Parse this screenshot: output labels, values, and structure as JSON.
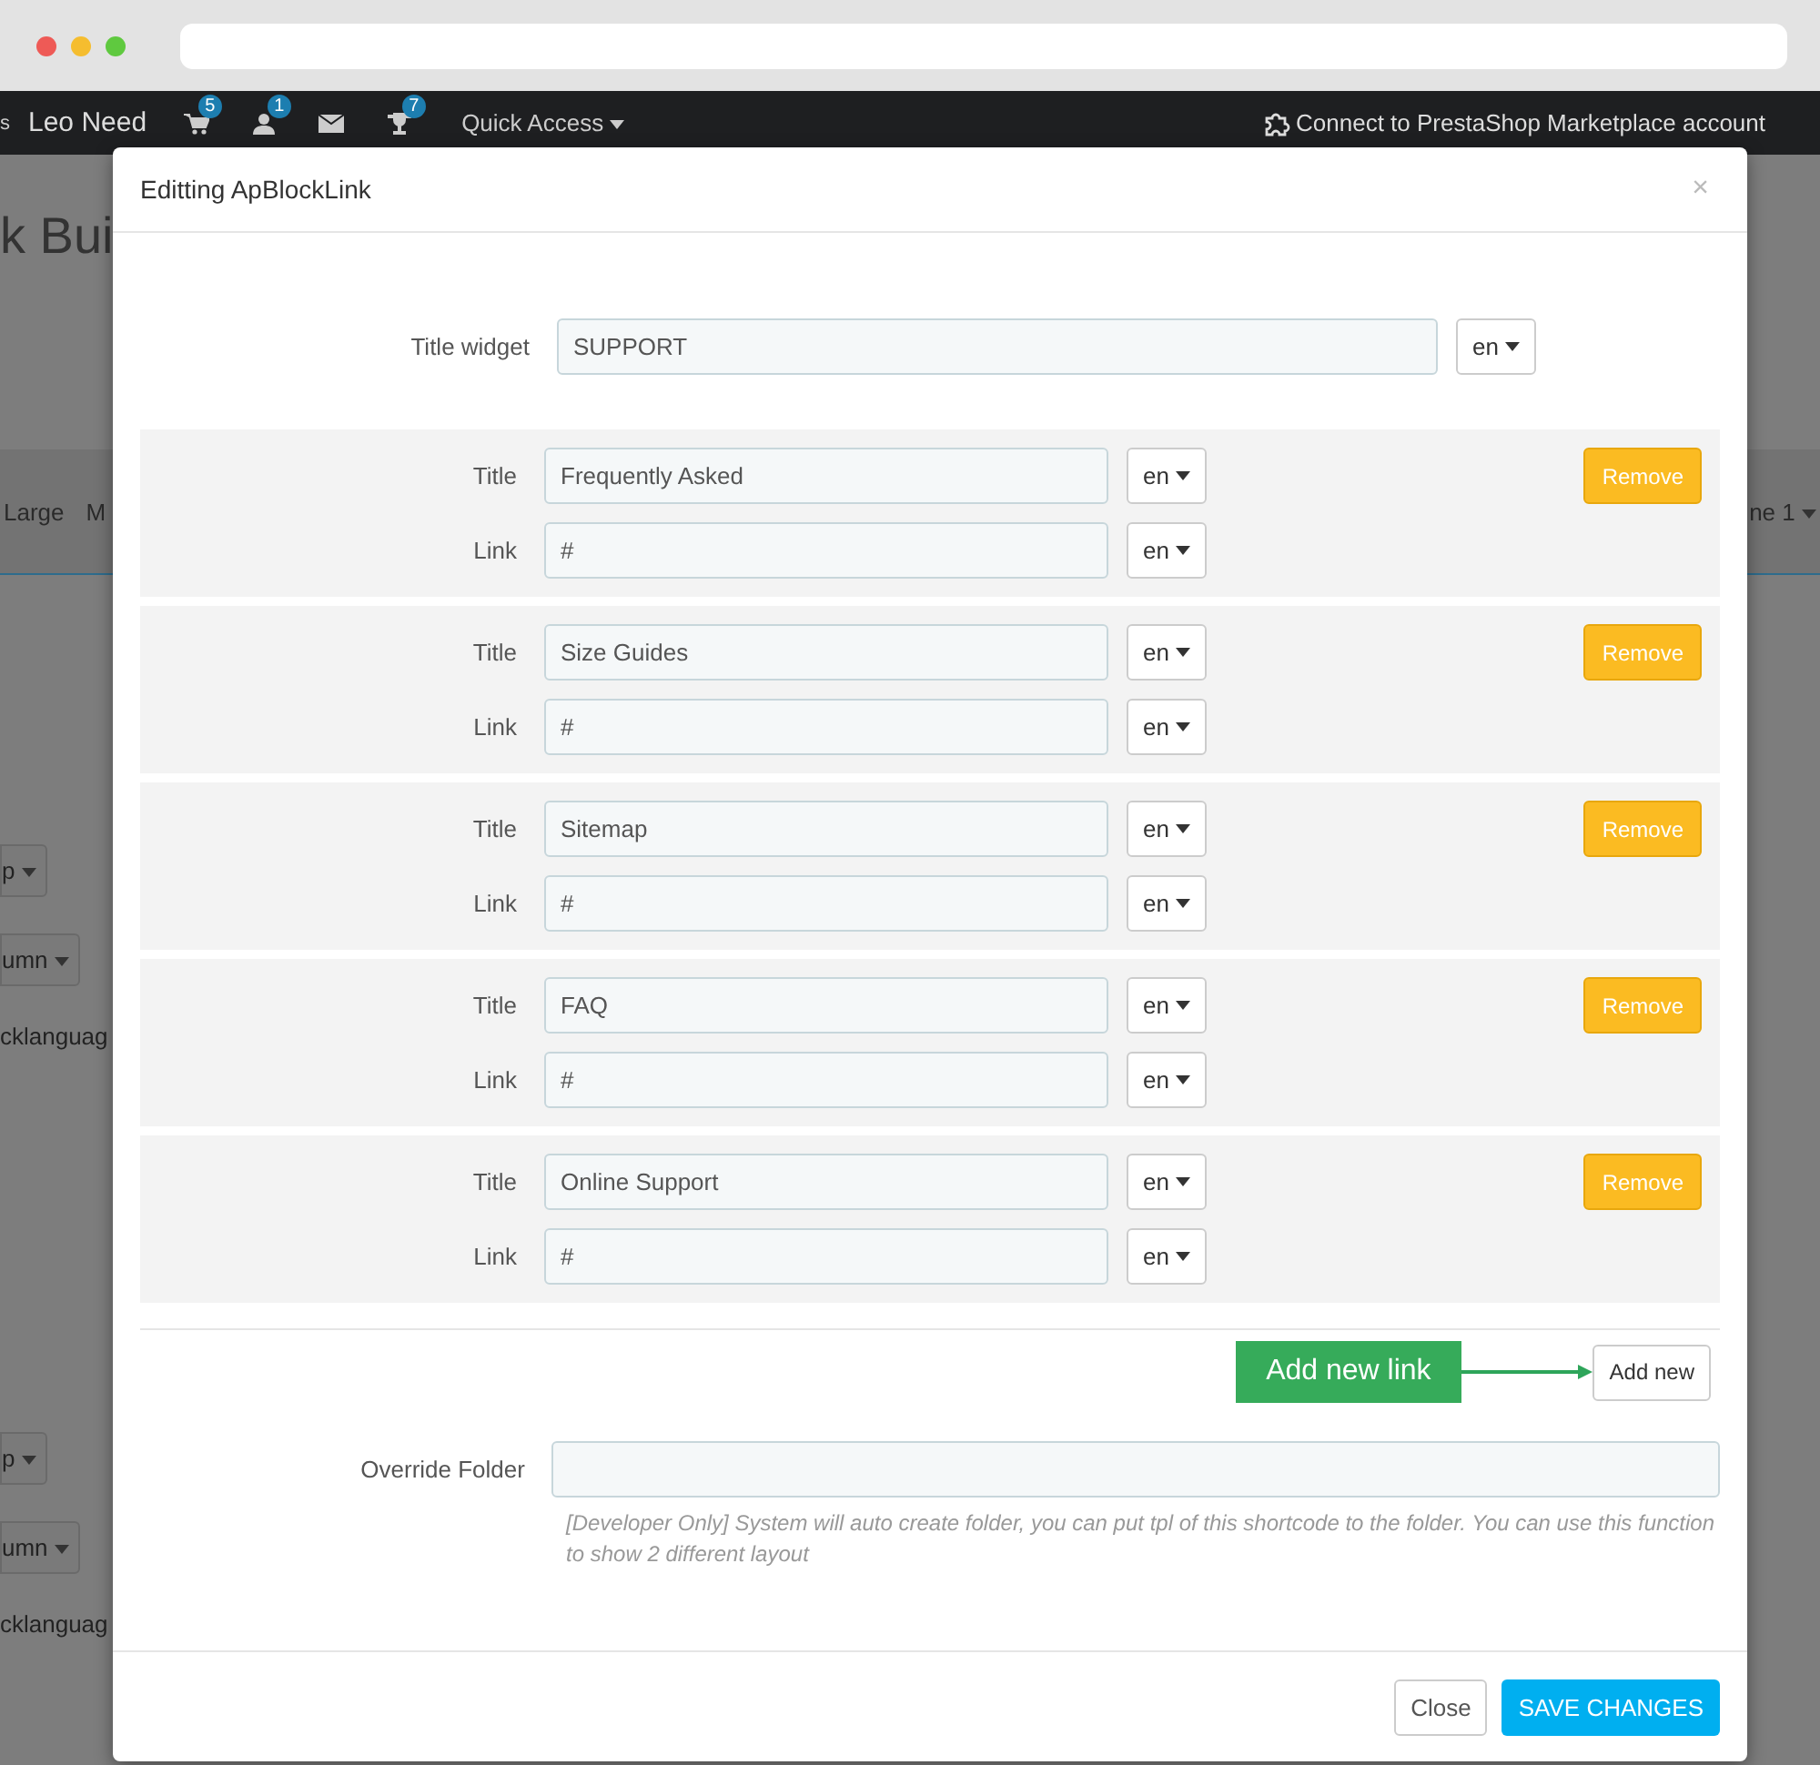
{
  "topbar": {
    "shop_name_cut": "s",
    "shop_name": "Leo Need",
    "icons": [
      {
        "kind": "cart",
        "count": "5"
      },
      {
        "kind": "user",
        "count": "1"
      },
      {
        "kind": "mail"
      },
      {
        "kind": "trophy",
        "count": "7"
      }
    ],
    "quick_access": "Quick Access",
    "marketplace_link": "Connect to PrestaShop Marketplace account"
  },
  "background_page": {
    "heading": "k Bui",
    "tabs": [
      "Large",
      "M"
    ],
    "right_tab": "ne 1",
    "blocks": [
      {
        "items": [
          {
            "kind": "dropdown",
            "label": "p"
          },
          {
            "kind": "dropdown",
            "label": "umn"
          },
          {
            "kind": "text",
            "label": "cklanguag"
          }
        ]
      },
      {
        "items": [
          {
            "kind": "dropdown",
            "label": "p"
          },
          {
            "kind": "dropdown",
            "label": "umn"
          },
          {
            "kind": "text",
            "label": "cklanguag"
          }
        ]
      }
    ]
  },
  "modal": {
    "title": "Editting ApBlockLink",
    "close": "×",
    "title_widget": {
      "label": "Title widget",
      "value": "SUPPORT",
      "lang": "en"
    },
    "links": [
      {
        "title_label": "Title",
        "title_value": "Frequently Asked",
        "title_lang": "en",
        "link_label": "Link",
        "link_value": "#",
        "link_lang": "en",
        "remove": "Remove"
      },
      {
        "title_label": "Title",
        "title_value": "Size Guides",
        "title_lang": "en",
        "link_label": "Link",
        "link_value": "#",
        "link_lang": "en",
        "remove": "Remove"
      },
      {
        "title_label": "Title",
        "title_value": "Sitemap",
        "title_lang": "en",
        "link_label": "Link",
        "link_value": "#",
        "link_lang": "en",
        "remove": "Remove"
      },
      {
        "title_label": "Title",
        "title_value": "FAQ",
        "title_lang": "en",
        "link_label": "Link",
        "link_value": "#",
        "link_lang": "en",
        "remove": "Remove"
      },
      {
        "title_label": "Title",
        "title_value": "Online Support",
        "title_lang": "en",
        "link_label": "Link",
        "link_value": "#",
        "link_lang": "en",
        "remove": "Remove"
      }
    ],
    "callout": "Add new link",
    "add_button": "Add new",
    "override": {
      "label": "Override Folder",
      "help": "[Developer Only] System will auto create folder, you can put tpl of this shortcode to the folder. You can use this function to show 2 different layout"
    },
    "buttons": {
      "close": "Close",
      "save": "SAVE CHANGES"
    }
  }
}
